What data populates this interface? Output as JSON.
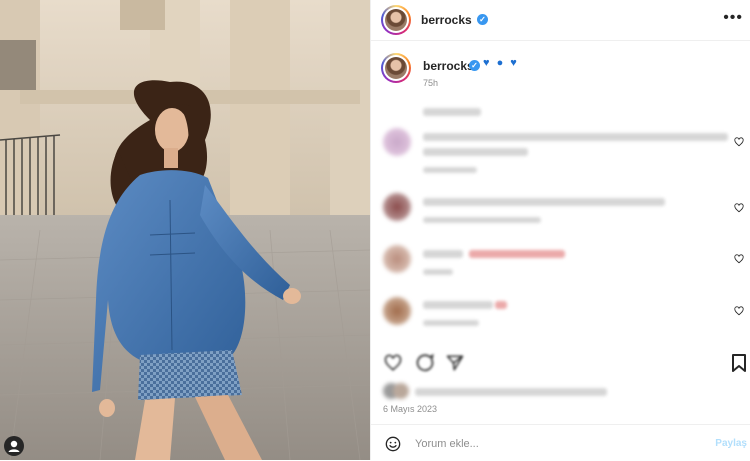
{
  "post": {
    "author": "berrocks",
    "caption_hearts": "♥ ● ♥",
    "time_ago": "75h",
    "date": "6 Mayıs 2023"
  },
  "comment_box": {
    "placeholder": "Yorum ekle...",
    "post_label": "Paylaş"
  },
  "colors": {
    "verified": "#3897f0",
    "post_button_disabled": "#b2dffc",
    "heart_blue": "#1d6fd1"
  },
  "icons": {
    "more": "more-options-icon",
    "like": "heart-icon",
    "comment": "comment-icon",
    "share": "share-icon",
    "save": "bookmark-icon",
    "emoji": "emoji-icon",
    "user": "user-icon"
  }
}
